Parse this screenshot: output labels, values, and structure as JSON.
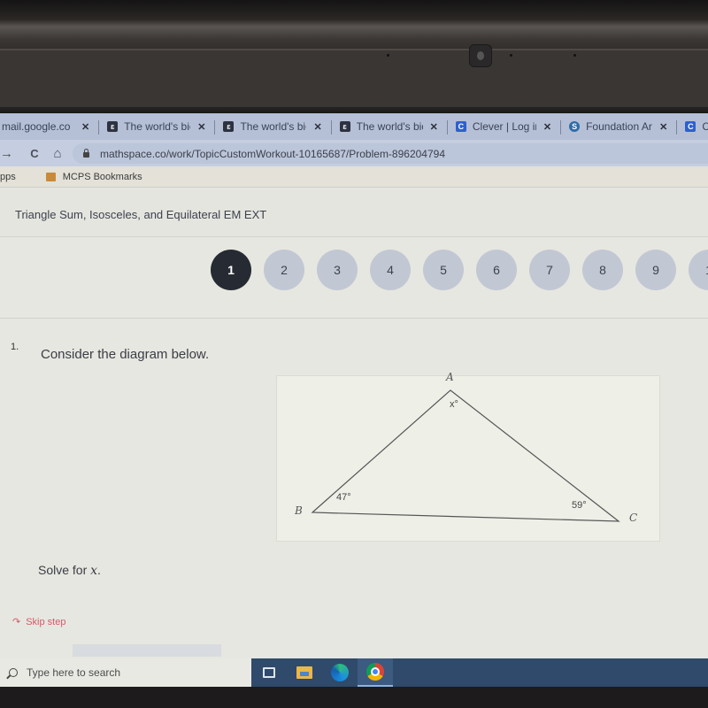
{
  "browser": {
    "tabs": [
      {
        "title": "mail.google.co",
        "favicon": "gmail-icon",
        "close": "✕"
      },
      {
        "title": "The world's bic",
        "favicon": "world-icon",
        "close": "✕"
      },
      {
        "title": "The world's bic",
        "favicon": "world-icon",
        "close": "✕"
      },
      {
        "title": "The world's bic",
        "favicon": "world-icon",
        "close": "✕"
      },
      {
        "title": "Clever | Log in",
        "favicon": "clever-icon",
        "close": "✕"
      },
      {
        "title": "Foundation Ar",
        "favicon": "foundation-icon",
        "close": "✕"
      },
      {
        "title": "Clever | Portal",
        "favicon": "clever-icon",
        "close": ""
      }
    ],
    "nav": {
      "forward": "→",
      "reload": "C",
      "home": "⌂"
    },
    "url": "mathspace.co/work/TopicCustomWorkout-10165687/Problem-896204794",
    "bookmarks": {
      "apps": "pps",
      "folder": "MCPS Bookmarks"
    }
  },
  "page": {
    "topic": "Triangle Sum, Isosceles, and Equilateral EM EXT",
    "steps": [
      "1",
      "2",
      "3",
      "4",
      "5",
      "6",
      "7",
      "8",
      "9",
      "1"
    ],
    "active_step": "1",
    "question_number": "1.",
    "prompt": "Consider the diagram below.",
    "diagram": {
      "vertices": {
        "A": "A",
        "B": "B",
        "C": "C"
      },
      "angles": {
        "A": "x°",
        "B": "47°",
        "C": "59°"
      }
    },
    "solve_prefix": "Solve for ",
    "solve_var": "x",
    "solve_suffix": ".",
    "skip_icon": "↷",
    "skip_label": "Skip step"
  },
  "taskbar": {
    "search_placeholder": "Type here to search",
    "apps": [
      "task-view-icon",
      "file-explorer-icon",
      "edge-icon",
      "chrome-icon"
    ]
  }
}
